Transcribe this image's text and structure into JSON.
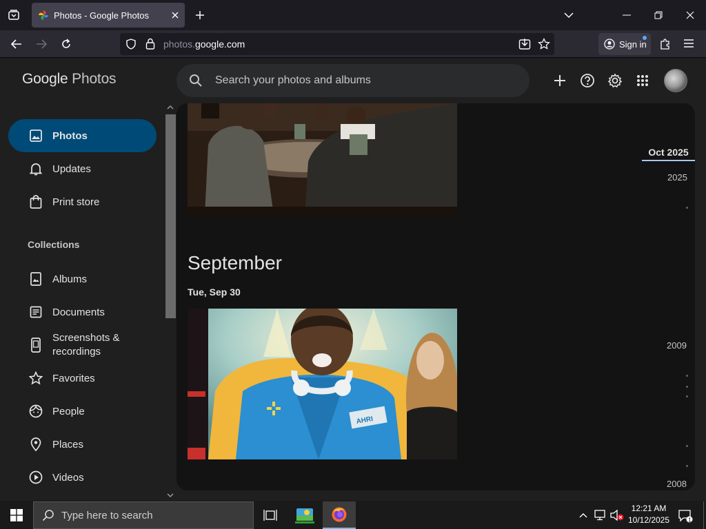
{
  "browser": {
    "tab_title": "Photos - Google Photos",
    "url_prefix": "photos.",
    "url_domain": "google.com",
    "sign_in_label": "Sign in"
  },
  "app": {
    "logo_google": "Google",
    "logo_photos": "Photos",
    "search_placeholder": "Search your photos and albums"
  },
  "sidebar": {
    "items": [
      {
        "label": "Photos",
        "icon": "image-icon"
      },
      {
        "label": "Updates",
        "icon": "bell-icon"
      },
      {
        "label": "Print store",
        "icon": "shopping-bag-icon"
      }
    ],
    "collections_header": "Collections",
    "collections": [
      {
        "label": "Albums",
        "icon": "album-icon"
      },
      {
        "label": "Documents",
        "icon": "document-icon"
      },
      {
        "label": "Screenshots &",
        "label2": "recordings",
        "icon": "phone-screenshot-icon"
      },
      {
        "label": "Favorites",
        "icon": "star-icon"
      },
      {
        "label": "People",
        "icon": "face-icon"
      },
      {
        "label": "Places",
        "icon": "location-pin-icon"
      },
      {
        "label": "Videos",
        "icon": "play-circle-icon"
      }
    ]
  },
  "main": {
    "month": "September",
    "day": "Tue, Sep 30",
    "badge_text": "AHRI"
  },
  "timeline": {
    "current": "Oct 2025",
    "years": [
      "2025",
      "2009",
      "2008"
    ]
  },
  "taskbar": {
    "search_placeholder": "Type here to search",
    "time": "12:21 AM",
    "date": "10/12/2025",
    "notification_count": "1"
  },
  "colors": {
    "active_nav_bg": "#004a77",
    "app_bg": "#1f1f1f",
    "content_bg": "#131314",
    "accent": "#a8c7fa"
  }
}
